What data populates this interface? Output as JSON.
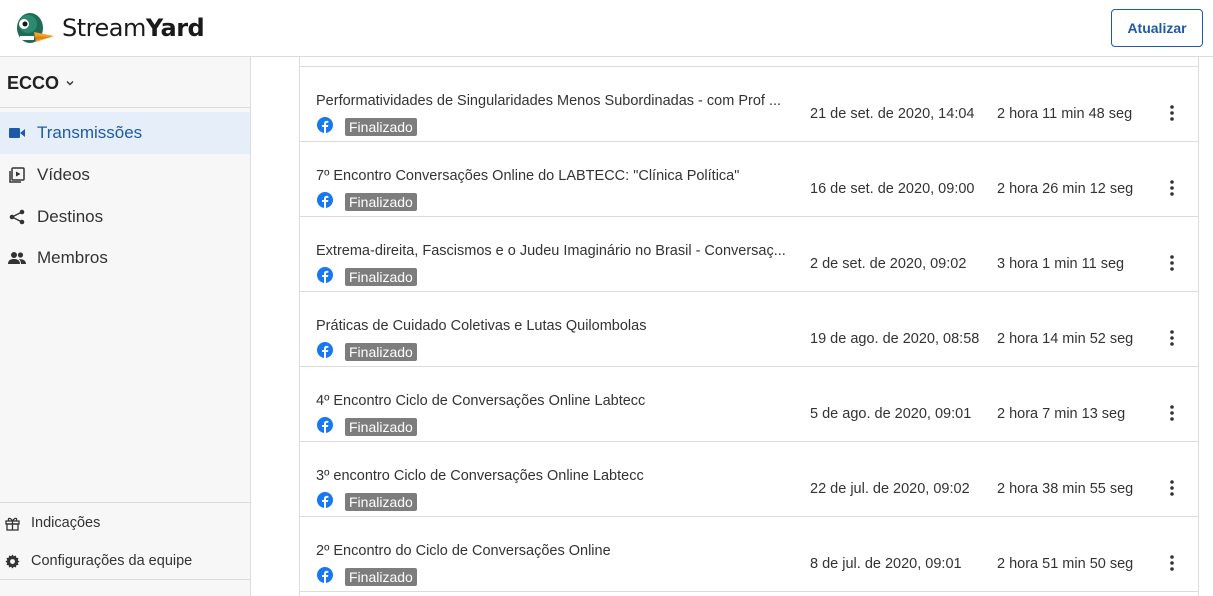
{
  "app": {
    "brand_light": "Stream",
    "brand_bold": "Yard",
    "update_button": "Atualizar",
    "accent": "#1e5aa8"
  },
  "sidebar": {
    "team_name": "ECCO",
    "items": [
      {
        "label": "Transmissões",
        "icon": "video-camera-icon",
        "active": true
      },
      {
        "label": "Vídeos",
        "icon": "video-library-icon",
        "active": false
      },
      {
        "label": "Destinos",
        "icon": "share-icon",
        "active": false
      },
      {
        "label": "Membros",
        "icon": "people-icon",
        "active": false
      }
    ],
    "footer": [
      {
        "label": "Indicações",
        "icon": "gift-icon"
      },
      {
        "label": "Configurações da equipe",
        "icon": "gear-icon"
      }
    ]
  },
  "broadcasts": [
    {
      "title": "Performatividades de Singularidades Menos Subordinadas - com Prof ...",
      "status": "Finalizado",
      "date": "21 de set. de 2020, 14:04",
      "duration": "2 hora 11 min 48 seg"
    },
    {
      "title": "7º Encontro Conversações Online do LABTECC: \"Clínica Política\"",
      "status": "Finalizado",
      "date": "16 de set. de 2020, 09:00",
      "duration": "2 hora 26 min 12 seg"
    },
    {
      "title": "Extrema-direita, Fascismos e o Judeu Imaginário no Brasil - Conversaç...",
      "status": "Finalizado",
      "date": "2 de set. de 2020, 09:02",
      "duration": "3 hora 1 min 11 seg"
    },
    {
      "title": "Práticas de Cuidado Coletivas e Lutas Quilombolas",
      "status": "Finalizado",
      "date": "19 de ago. de 2020, 08:58",
      "duration": "2 hora 14 min 52 seg"
    },
    {
      "title": "4º Encontro Ciclo de Conversações Online Labtecc",
      "status": "Finalizado",
      "date": "5 de ago. de 2020, 09:01",
      "duration": "2 hora 7 min 13 seg"
    },
    {
      "title": "3º encontro Ciclo de Conversações Online Labtecc",
      "status": "Finalizado",
      "date": "22 de jul. de 2020, 09:02",
      "duration": "2 hora 38 min 55 seg"
    },
    {
      "title": "2º Encontro do Ciclo de Conversações Online",
      "status": "Finalizado",
      "date": "8 de jul. de 2020, 09:01",
      "duration": "2 hora 51 min 50 seg"
    }
  ]
}
